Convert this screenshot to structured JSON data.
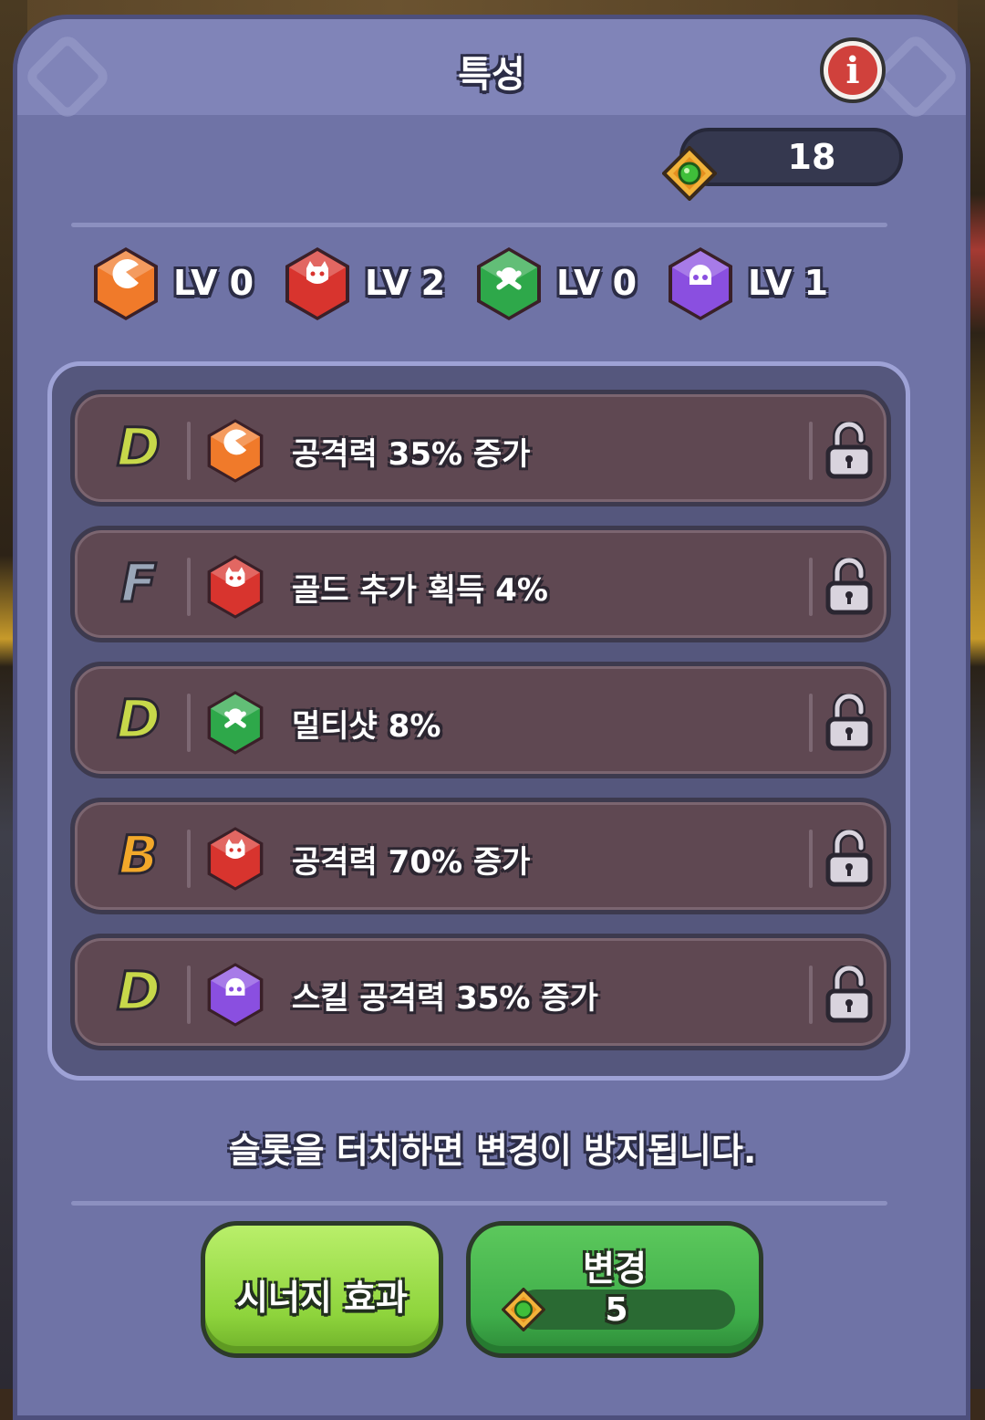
{
  "header": {
    "title": "특성"
  },
  "currency": {
    "value": "18",
    "gem_color": "#3fbf3a",
    "frame_color": "#f2b33a"
  },
  "levels": [
    {
      "label": "LV 0",
      "color": "#f07a2a",
      "icon": "pacman-icon"
    },
    {
      "label": "LV 2",
      "color": "#d8342e",
      "icon": "cat-face-icon"
    },
    {
      "label": "LV 0",
      "color": "#2ea84a",
      "icon": "crossbones-icon"
    },
    {
      "label": "LV 1",
      "color": "#8a4fe0",
      "icon": "skull-icon"
    }
  ],
  "slots": [
    {
      "grade": "D",
      "grade_color": "#c7d84a",
      "color": "#f07a2a",
      "icon": "pacman-icon",
      "text": "공격력 35% 증가"
    },
    {
      "grade": "F",
      "grade_color": "#9aa6b8",
      "color": "#d8342e",
      "icon": "cat-face-icon",
      "text": "골드 추가 획득 4%"
    },
    {
      "grade": "D",
      "grade_color": "#c7d84a",
      "color": "#2ea84a",
      "icon": "crossbones-icon",
      "text": "멀티샷 8%"
    },
    {
      "grade": "B",
      "grade_color": "#f2a82a",
      "color": "#d8342e",
      "icon": "cat-face-icon",
      "text": "공격력 70% 증가"
    },
    {
      "grade": "D",
      "grade_color": "#c7d84a",
      "color": "#8a4fe0",
      "icon": "skull-icon",
      "text": "스킬 공격력 35% 증가"
    }
  ],
  "hint": "슬롯을 터치하면 변경이 방지됩니다.",
  "buttons": {
    "synergy_label": "시너지 효과",
    "change_label": "변경",
    "change_cost": "5"
  }
}
